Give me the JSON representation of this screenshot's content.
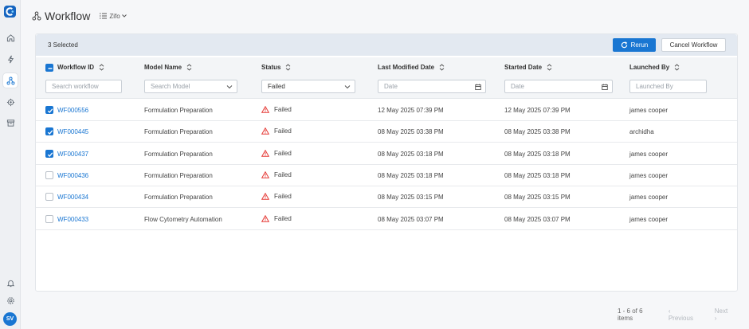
{
  "header": {
    "title": "Workflow",
    "org": "Zifo"
  },
  "user": {
    "initials": "SV"
  },
  "selection": {
    "text": "3 Selected"
  },
  "actions": {
    "rerun": "Rerun",
    "cancel": "Cancel Workflow"
  },
  "columns": [
    "Workflow ID",
    "Model Name",
    "Status",
    "Last Modified Date",
    "Started Date",
    "Launched By"
  ],
  "filters": {
    "workflow_placeholder": "Search workflow",
    "model_placeholder": "Search Model",
    "status_value": "Failed",
    "last_modified_placeholder": "Date",
    "started_placeholder": "Date",
    "launched_by_placeholder": "Launched By"
  },
  "rows": [
    {
      "id": "WF000556",
      "model": "Formulation Preparation",
      "status": "Failed",
      "last_modified": "12 May 2025 07:39 PM",
      "started": "12 May 2025 07:39 PM",
      "launched_by": "james cooper",
      "checked": true
    },
    {
      "id": "WF000445",
      "model": "Formulation Preparation",
      "status": "Failed",
      "last_modified": "08 May 2025 03:38 PM",
      "started": "08 May 2025 03:38 PM",
      "launched_by": "archidha",
      "checked": true
    },
    {
      "id": "WF000437",
      "model": "Formulation Preparation",
      "status": "Failed",
      "last_modified": "08 May 2025 03:18 PM",
      "started": "08 May 2025 03:18 PM",
      "launched_by": "james cooper",
      "checked": true
    },
    {
      "id": "WF000436",
      "model": "Formulation Preparation",
      "status": "Failed",
      "last_modified": "08 May 2025 03:18 PM",
      "started": "08 May 2025 03:18 PM",
      "launched_by": "james cooper",
      "checked": false
    },
    {
      "id": "WF000434",
      "model": "Formulation Preparation",
      "status": "Failed",
      "last_modified": "08 May 2025 03:15 PM",
      "started": "08 May 2025 03:15 PM",
      "launched_by": "james cooper",
      "checked": false
    },
    {
      "id": "WF000433",
      "model": "Flow Cytometry Automation",
      "status": "Failed",
      "last_modified": "08 May 2025 03:07 PM",
      "started": "08 May 2025 03:07 PM",
      "launched_by": "james cooper",
      "checked": false
    }
  ],
  "pagination": {
    "summary": "1 - 6 of 6 items",
    "prev": "Previous",
    "next": "Next"
  },
  "colors": {
    "accent": "#1976d2",
    "failed": "#e53935",
    "selbar": "#e3e9f1"
  }
}
